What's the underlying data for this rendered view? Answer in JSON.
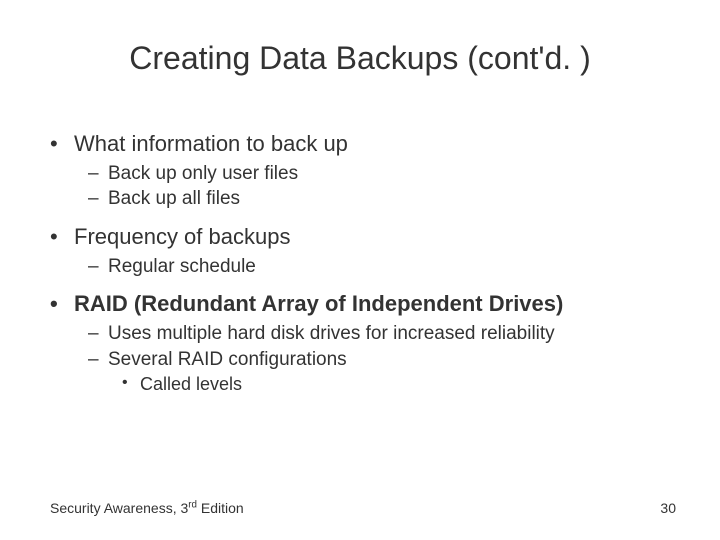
{
  "title": "Creating Data Backups (cont'd. )",
  "bullets": {
    "b1": "What information to back up",
    "b1_1": "Back up only user files",
    "b1_2": "Back up all files",
    "b2": "Frequency of backups",
    "b2_1": "Regular schedule",
    "b3": "RAID (Redundant Array of Independent Drives)",
    "b3_1": "Uses multiple hard disk drives for increased reliability",
    "b3_2": "Several RAID configurations",
    "b3_2_1": "Called levels"
  },
  "footer": {
    "left_pre": "Security Awareness, 3",
    "left_sup": "rd",
    "left_post": " Edition",
    "page": "30"
  }
}
